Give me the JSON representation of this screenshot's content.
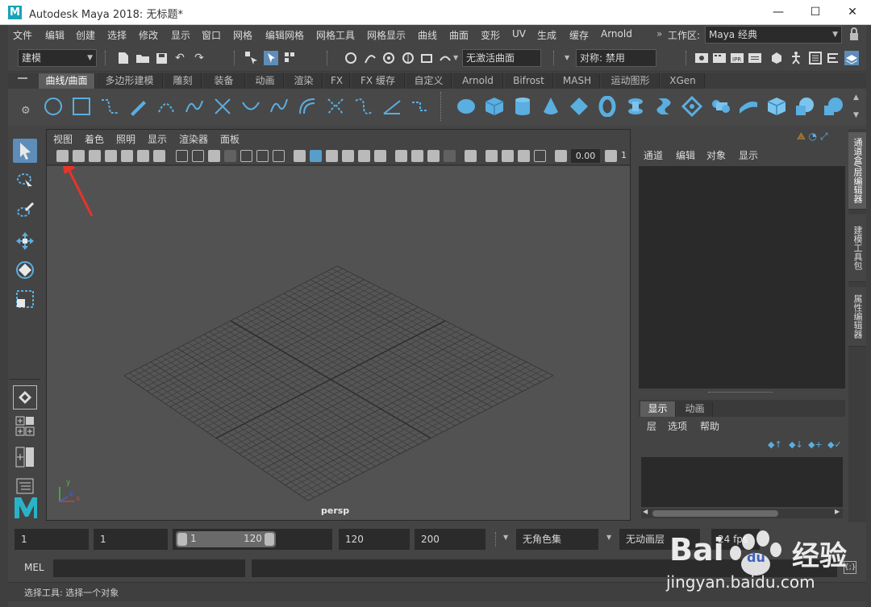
{
  "window": {
    "title": "Autodesk Maya 2018: 无标题*",
    "logo_letter": "M",
    "controls": [
      "—",
      "☐",
      "✕"
    ]
  },
  "menubar": {
    "items": [
      "文件",
      "编辑",
      "创建",
      "选择",
      "修改",
      "显示",
      "窗口",
      "网格",
      "编辑网格",
      "网格工具",
      "网格显示",
      "曲线",
      "曲面",
      "变形",
      "UV",
      "生成",
      "缓存",
      "Arnold"
    ],
    "workspace_label": "工作区:",
    "workspace_value": "Maya 经典"
  },
  "statusline": {
    "mode": "建模",
    "live_surface": "无激活曲面",
    "symmetry": "对称: 禁用"
  },
  "shelf": {
    "tabs": [
      "曲线/曲面",
      "多边形建模",
      "雕刻",
      "装备",
      "动画",
      "渲染",
      "FX",
      "FX 缓存",
      "自定义",
      "Arnold",
      "Bifrost",
      "MASH",
      "运动图形",
      "XGen"
    ],
    "active_tab": 0
  },
  "viewport": {
    "menu": [
      "视图",
      "着色",
      "照明",
      "显示",
      "渲染器",
      "面板"
    ],
    "field_value": "0.00",
    "field_value2": "1",
    "camera_label": "persp",
    "axis_x": "x",
    "axis_y": "y",
    "axis_z": "z"
  },
  "channelbox": {
    "menu": [
      "通道",
      "编辑",
      "对象",
      "显示"
    ]
  },
  "layers": {
    "tabs": [
      "显示",
      "动画"
    ],
    "menu": [
      "层",
      "选项",
      "帮助"
    ]
  },
  "sidetabs": [
    "通道盒/层编辑器",
    "建模工具包",
    "属性编辑器"
  ],
  "timeline": {
    "start": "1",
    "current": "1",
    "range_start": "1",
    "range_end": "120",
    "end": "120",
    "anim_end": "200",
    "character_set": "无角色集",
    "anim_layer": "无动画层",
    "fps": "24 fps"
  },
  "commandline": {
    "label": "MEL"
  },
  "helpline": {
    "text": "选择工具: 选择一个对象"
  },
  "watermark": {
    "brand": "Bai",
    "brand2": "经验",
    "url": "jingyan.baidu.com"
  },
  "colors": {
    "shelf_icon_blue": "#5aaee0",
    "accent_cyan": "#1aa2b8",
    "arrow_red": "#e8332a"
  }
}
